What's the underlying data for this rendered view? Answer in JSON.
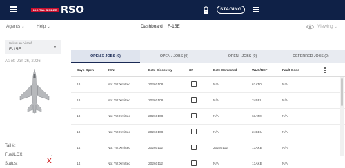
{
  "header": {
    "logo_badge": "DIGITAL BINDER",
    "logo_text": "RSO",
    "environment_label": "STAGING",
    "icons": [
      "menu-icon",
      "lock-icon",
      "apps-grid-icon"
    ]
  },
  "subnav": {
    "agents_label": "Agents",
    "help_label": "Help",
    "breadcrumb_root": "Dashboard",
    "breadcrumb_current": "F-15E",
    "viewing_label": "Viewing",
    "chevron": "⌄"
  },
  "left_panel": {
    "aircraft_select_label": "Select an Aircraft",
    "aircraft_select_value": "F-15E :",
    "as_of": "As of: Jan 26, 2026",
    "tail_label": "Tail #:",
    "fuel_label": "Fuel/LOX:",
    "fuel_value": "-",
    "status_label": "Status:",
    "status_value": "X",
    "status_color": "#d32f2f"
  },
  "tabs": [
    {
      "label": "OPEN X JOBS (0)",
      "active": true
    },
    {
      "label": "OPEN / JOBS (0)",
      "active": false
    },
    {
      "label": "OPEN - JOBS (0)",
      "active": false
    },
    {
      "label": "DEFERRED JOBS (0)",
      "active": false
    }
  ],
  "table": {
    "columns": [
      "Days Open",
      "JCN",
      "Date Discovery",
      "XF",
      "Date Corrected",
      "WUC/REF",
      "Fault Code"
    ],
    "rows": [
      {
        "days_open": "18",
        "jcn": "Not Yet Xmitted",
        "date_discovery": "20260108",
        "xf": false,
        "date_corrected": "N/A",
        "wuc_ref": "63AT0",
        "fault_code": "N/A"
      },
      {
        "days_open": "18",
        "jcn": "Not Yet Xmitted",
        "date_discovery": "20260108",
        "xf": false,
        "date_corrected": "N/A",
        "wuc_ref": "24BEU",
        "fault_code": "N/A"
      },
      {
        "days_open": "18",
        "jcn": "Not Yet Xmitted",
        "date_discovery": "20260108",
        "xf": false,
        "date_corrected": "N/A",
        "wuc_ref": "63AT0",
        "fault_code": "N/A"
      },
      {
        "days_open": "18",
        "jcn": "Not Yet Xmitted",
        "date_discovery": "20260108",
        "xf": false,
        "date_corrected": "N/A",
        "wuc_ref": "24BEU",
        "fault_code": "N/A"
      },
      {
        "days_open": "14",
        "jcn": "Not Yet Xmitted",
        "date_discovery": "20260112",
        "xf": false,
        "date_corrected": "20260112",
        "wuc_ref": "13AKB",
        "fault_code": "N/A"
      },
      {
        "days_open": "14",
        "jcn": "Not Yet Xmitted",
        "date_discovery": "20260112",
        "xf": false,
        "date_corrected": "N/A",
        "wuc_ref": "13AKB",
        "fault_code": "N/A"
      }
    ]
  },
  "colors": {
    "header_bg": "#0f2147",
    "brand_red": "#c8102e",
    "tab_bg": "#e8ebf1",
    "tab_active_accent": "#1a2a55"
  }
}
